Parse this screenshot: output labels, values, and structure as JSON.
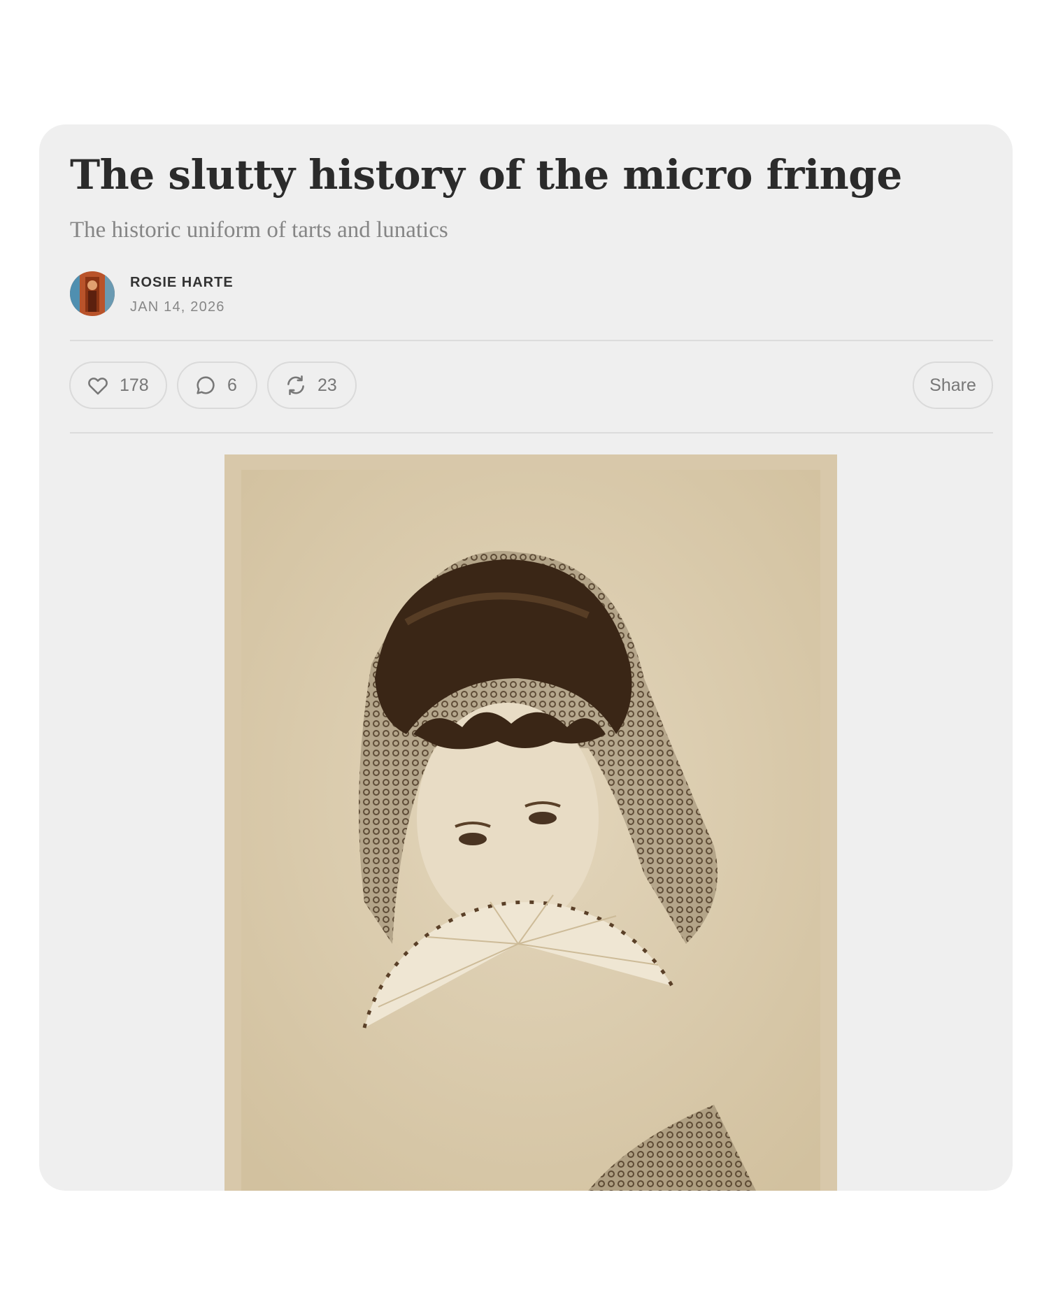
{
  "post": {
    "title": "The slutty history of the micro fringe",
    "subtitle": "The historic uniform of tarts and lunatics",
    "author": "ROSIE HARTE",
    "date": "JAN 14, 2026"
  },
  "actions": {
    "likes": "178",
    "comments": "6",
    "restacks": "23",
    "share_label": "Share"
  },
  "icons": {
    "like": "heart-icon",
    "comment": "comment-bubble-icon",
    "restack": "restack-arrows-icon"
  },
  "colors": {
    "card_background": "#efefef",
    "title_text": "#2b2b2b",
    "muted_text": "#858585",
    "photo_sepia": "#dccdb0"
  }
}
